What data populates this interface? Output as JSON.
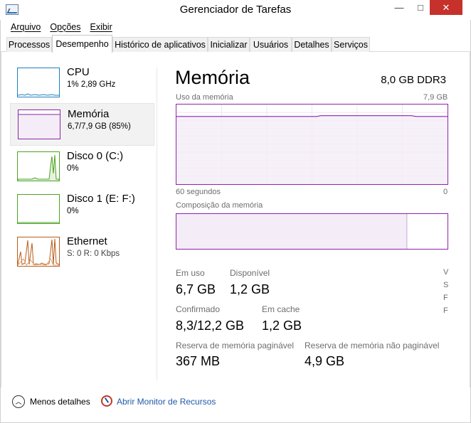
{
  "window": {
    "title": "Gerenciador de Tarefas",
    "minimize": "—",
    "maximize": "□",
    "close": "✕"
  },
  "menu": [
    "Arquivo",
    "Opções",
    "Exibir"
  ],
  "tabs": [
    "Processos",
    "Desempenho",
    "Histórico de aplicativos",
    "Inicializar",
    "Usuários",
    "Detalhes",
    "Serviços"
  ],
  "active_tab": "Desempenho",
  "sidebar": [
    {
      "title": "CPU",
      "sub": "1% 2,89 GHz",
      "color": "#1e7fc2"
    },
    {
      "title": "Memória",
      "sub": "6,7/7,9 GB (85%)",
      "color": "#8b26a6"
    },
    {
      "title": "Disco 0 (C:)",
      "sub": "0%",
      "color": "#4da324"
    },
    {
      "title": "Disco 1 (E: F:)",
      "sub": "0%",
      "color": "#4da324"
    },
    {
      "title": "Ethernet",
      "sub": "S: 0 R: 0 Kbps",
      "color": "#b85d1b"
    }
  ],
  "detail": {
    "title": "Memória",
    "spec": "8,0 GB DDR3",
    "usage_label": "Uso da memória",
    "usage_max": "7,9 GB",
    "time_label": "60 segundos",
    "time_end": "0",
    "composition_label": "Composição da memória",
    "composition_in_use_fraction": 0.85,
    "stats": {
      "in_use_label": "Em uso",
      "in_use_value": "6,7 GB",
      "available_label": "Disponível",
      "available_value": "1,2 GB",
      "committed_label": "Confirmado",
      "committed_value": "8,3/12,2 GB",
      "cached_label": "Em cache",
      "cached_value": "1,2 GB",
      "paged_label": "Reserva de memória paginável",
      "paged_value": "367 MB",
      "nonpaged_label": "Reserva de memória não paginável",
      "nonpaged_value": "4,9 GB"
    },
    "cut_labels": [
      "V",
      "S",
      "F",
      "F"
    ]
  },
  "footer": {
    "less_details": "Menos detalhes",
    "resource_monitor": "Abrir Monitor de Recursos"
  },
  "usage_series": [
    85,
    85,
    85,
    85,
    85,
    85,
    85,
    85,
    85,
    85,
    85,
    85,
    85,
    85,
    85,
    85,
    85,
    85,
    85,
    85,
    85,
    85,
    85,
    85,
    85,
    85,
    85,
    85,
    85,
    85,
    85,
    85,
    86,
    86,
    86,
    86,
    86,
    86,
    86,
    86,
    86,
    86,
    86,
    86,
    86,
    86,
    86,
    86,
    86,
    86,
    86,
    86,
    86,
    85,
    85,
    85,
    85,
    85,
    85,
    85,
    85
  ]
}
